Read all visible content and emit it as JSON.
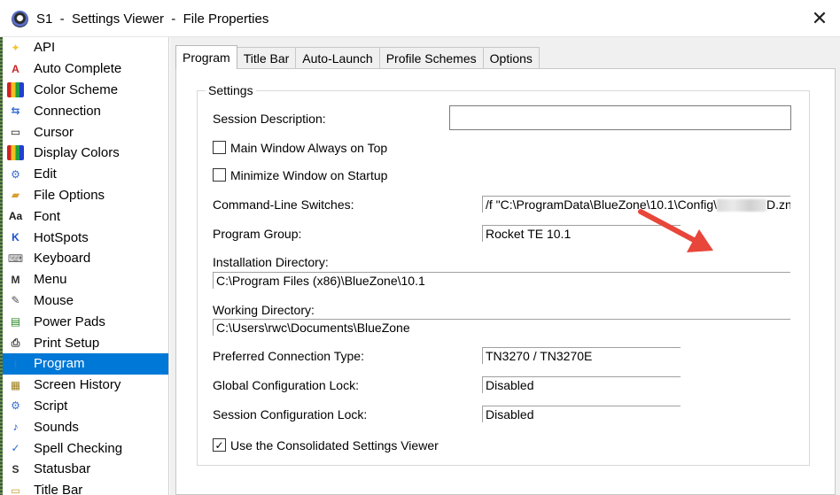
{
  "window": {
    "title": "S1  -  Settings Viewer  -  File Properties",
    "close_glyph": "✕"
  },
  "sidebar": {
    "items": [
      {
        "label": "API",
        "icon": "api-icon",
        "glyph": "✦",
        "color": "#f4c430"
      },
      {
        "label": "Auto Complete",
        "icon": "auto-complete-icon",
        "glyph": "A",
        "color": "#cc2222"
      },
      {
        "label": "Color Scheme",
        "icon": "color-scheme-icon",
        "glyph": "",
        "color": "#7a3db8"
      },
      {
        "label": "Connection",
        "icon": "connection-icon",
        "glyph": "⇆",
        "color": "#3a6fd0"
      },
      {
        "label": "Cursor",
        "icon": "cursor-icon",
        "glyph": "▭",
        "color": "#1a1a1a"
      },
      {
        "label": "Display Colors",
        "icon": "display-colors-icon",
        "glyph": "",
        "color": "#2aa02a"
      },
      {
        "label": "Edit",
        "icon": "edit-icon",
        "glyph": "⚙",
        "color": "#3a6fd0"
      },
      {
        "label": "File Options",
        "icon": "file-options-icon",
        "glyph": "▰",
        "color": "#d8a030"
      },
      {
        "label": "Font",
        "icon": "font-icon",
        "glyph": "Aa",
        "color": "#1a1a1a"
      },
      {
        "label": "HotSpots",
        "icon": "hotspots-icon",
        "glyph": "K",
        "color": "#1a4fd0"
      },
      {
        "label": "Keyboard",
        "icon": "keyboard-icon",
        "glyph": "⌨",
        "color": "#606060"
      },
      {
        "label": "Menu",
        "icon": "menu-icon",
        "glyph": "M",
        "color": "#303030"
      },
      {
        "label": "Mouse",
        "icon": "mouse-icon",
        "glyph": "✎",
        "color": "#505050"
      },
      {
        "label": "Power Pads",
        "icon": "power-pads-icon",
        "glyph": "▤",
        "color": "#2a8a2a"
      },
      {
        "label": "Print Setup",
        "icon": "print-setup-icon",
        "glyph": "⎙",
        "color": "#404040"
      },
      {
        "label": "Program",
        "icon": "program-icon",
        "glyph": "i",
        "color": "#2a7ad0"
      },
      {
        "label": "Screen History",
        "icon": "screen-history-icon",
        "glyph": "▦",
        "color": "#a08020"
      },
      {
        "label": "Script",
        "icon": "script-icon",
        "glyph": "⚙",
        "color": "#3a6fd0"
      },
      {
        "label": "Sounds",
        "icon": "sounds-icon",
        "glyph": "♪",
        "color": "#1a4fd0"
      },
      {
        "label": "Spell Checking",
        "icon": "spell-checking-icon",
        "glyph": "✓",
        "color": "#2a6ad0"
      },
      {
        "label": "Statusbar",
        "icon": "statusbar-icon",
        "glyph": "S",
        "color": "#303030"
      },
      {
        "label": "Title Bar",
        "icon": "title-bar-icon",
        "glyph": "▭",
        "color": "#c8a030"
      }
    ],
    "selected_index": 15
  },
  "tabs": [
    "Program",
    "Title Bar",
    "Auto-Launch",
    "Profile Schemes",
    "Options"
  ],
  "active_tab": "Program",
  "settings": {
    "group_title": "Settings",
    "session_description_label": "Session Description:",
    "session_description_value": "",
    "main_window_on_top_label": "Main Window Always on Top",
    "main_window_on_top_checked": false,
    "minimize_on_startup_label": "Minimize Window on Startup",
    "minimize_on_startup_checked": false,
    "command_line_label": "Command-Line Switches:",
    "command_line_value_start": "/f \"C:\\ProgramData\\BlueZone\\10.1\\Config\\",
    "command_line_value_end": "D.zn",
    "program_group_label": "Program Group:",
    "program_group_value": "Rocket TE 10.1",
    "installation_dir_label": "Installation Directory:",
    "installation_dir_value": "C:\\Program Files (x86)\\BlueZone\\10.1",
    "working_dir_label": "Working Directory:",
    "working_dir_value": "C:\\Users\\rwc\\Documents\\BlueZone",
    "preferred_connection_label": "Preferred Connection Type:",
    "preferred_connection_value": "TN3270 / TN3270E",
    "global_lock_label": "Global Configuration Lock:",
    "global_lock_value": "Disabled",
    "session_lock_label": "Session Configuration Lock:",
    "session_lock_value": "Disabled",
    "consolidated_viewer_label": "Use the Consolidated Settings Viewer",
    "consolidated_viewer_checked": true,
    "check_glyph": "✓"
  },
  "colors": {
    "selection": "#0078d7",
    "arrow": "#e8463a"
  }
}
